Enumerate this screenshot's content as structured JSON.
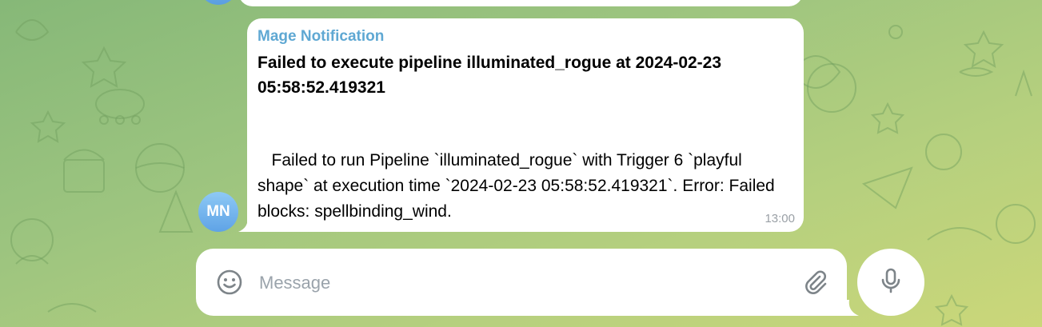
{
  "message": {
    "sender": "Mage Notification",
    "avatar_initials": "MN",
    "title": "Failed to execute pipeline illuminated_rogue at 2024-02-23 05:58:52.419321",
    "body": "   Failed to run Pipeline `illuminated_rogue` with Trigger 6 `playful shape` at execution time `2024-02-23 05:58:52.419321`. Error: Failed blocks: spellbinding_wind.",
    "time": "13:00"
  },
  "composer": {
    "placeholder": "Message",
    "emoji_icon": "smiley-icon",
    "attach_icon": "paperclip-icon",
    "mic_icon": "microphone-icon"
  },
  "colors": {
    "sender": "#5fa8d3",
    "avatar": "#6aade9",
    "background": "#9cc47f"
  }
}
